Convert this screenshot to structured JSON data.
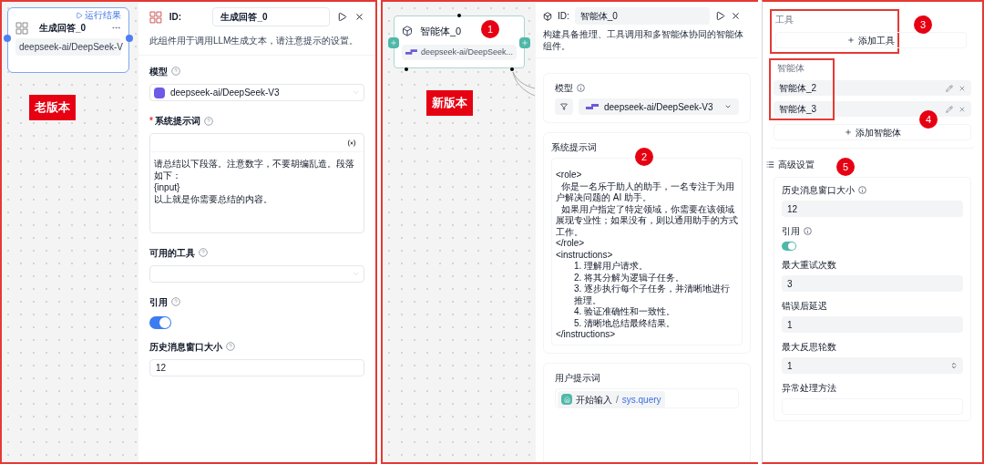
{
  "old_version": {
    "label": "老版本",
    "node": {
      "title": "生成回答_0",
      "run_label": "运行结果",
      "model": "deepseek-ai/DeepSeek-V"
    },
    "panel": {
      "id_label": "ID:",
      "id_value": "生成回答_0",
      "description": "此组件用于调用LLM生成文本，请注意提示的设置。",
      "model_label": "模型",
      "model_value": "deepseek-ai/DeepSeek-V3",
      "system_prompt_label": "系统提示词",
      "required_mark": "*",
      "system_prompt_lines": [
        "请总结以下段落。注意数字，不要胡编乱造。段落如下：",
        "{input}",
        "以上就是你需要总结的内容。"
      ],
      "tools_label": "可用的工具",
      "citation_label": "引用",
      "citation_on": true,
      "history_label": "历史消息窗口大小",
      "history_value": "12"
    }
  },
  "new_version": {
    "label": "新版本",
    "node": {
      "title": "智能体_0",
      "model": "deepseek-ai/DeepSeek..."
    },
    "panel": {
      "id_label": "ID:",
      "id_value": "智能体_0",
      "description": "构建具备推理、工具调用和多智能体协同的智能体组件。",
      "model_label": "模型",
      "model_value": "deepseek-ai/DeepSeek-V3",
      "system_prompt_label": "系统提示词",
      "system_prompt_lines": [
        {
          "text": "<role>",
          "indented": false
        },
        {
          "text": "  你是一名乐于助人的助手，一名专注于为用户解决问题的 AI 助手。",
          "indented": false
        },
        {
          "text": "  如果用户指定了特定领域，你需要在该领域展现专业性；如果没有，则以通用助手的方式工作。",
          "indented": false
        },
        {
          "text": "</role>",
          "indented": false
        },
        {
          "text": "<instructions>",
          "indented": false
        },
        {
          "text": "1. 理解用户请求。",
          "indented": true
        },
        {
          "text": "2. 将其分解为逻辑子任务。",
          "indented": true
        },
        {
          "text": "3. 逐步执行每个子任务，并清晰地进行推理。",
          "indented": true
        },
        {
          "text": "4. 验证准确性和一致性。",
          "indented": true
        },
        {
          "text": "5. 清晰地总结最终结果。",
          "indented": true
        },
        {
          "text": "</instructions>",
          "indented": false
        }
      ],
      "user_prompt_label": "用户提示词",
      "user_prompt_chip": {
        "source": "开始输入",
        "separator": "/",
        "variable": "sys.query"
      }
    },
    "side": {
      "tools_label": "工具",
      "add_tool": "添加工具",
      "agents_label": "智能体",
      "agents": [
        "智能体_2",
        "智能体_3"
      ],
      "add_agent": "添加智能体",
      "advanced_label": "高级设置",
      "fields": [
        {
          "kind": "input",
          "label": "历史消息窗口大小",
          "info": true,
          "value": "12"
        },
        {
          "kind": "toggle",
          "label": "引用",
          "info": true,
          "on": true
        },
        {
          "kind": "input",
          "label": "最大重试次数",
          "info": false,
          "value": "3"
        },
        {
          "kind": "input",
          "label": "错误后延迟",
          "info": false,
          "value": "1"
        },
        {
          "kind": "number",
          "label": "最大反思轮数",
          "info": false,
          "value": "1"
        },
        {
          "kind": "select",
          "label": "异常处理方法",
          "info": false
        }
      ]
    }
  },
  "annotations": [
    "1",
    "2",
    "3",
    "4",
    "5"
  ]
}
